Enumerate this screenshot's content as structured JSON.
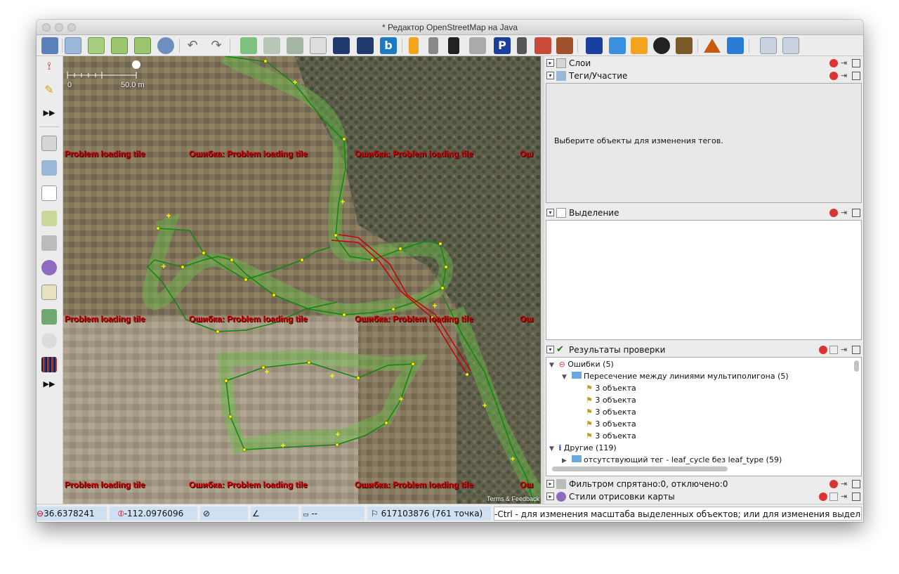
{
  "window": {
    "title": "* Редактор OpenStreetMap на Java"
  },
  "map": {
    "scale_zero": "0",
    "scale_label": "50.0 m",
    "tile_error": "Problem loading tile",
    "tile_error_ru": "Ошибка: Problem loading tile",
    "tile_error_cut": "Ош",
    "attribution": "Terms & Feedback"
  },
  "panels": {
    "layers": {
      "title": "Слои"
    },
    "tags": {
      "title": "Теги/Участие",
      "empty": "Выберите объекты для изменения тегов."
    },
    "selection": {
      "title": "Выделение"
    },
    "validation": {
      "title": "Результаты проверки",
      "errors": "Ошибки (5)",
      "group": "Пересечение между линиями мультиполигона (5)",
      "items": [
        "3 объекта",
        "3 объекта",
        "3 объекта",
        "3 объекта",
        "3 объекта"
      ],
      "others": "Другие (119)",
      "others_first": "отсутствующий тег - leaf_cycle без leaf_type (59)"
    },
    "filter": {
      "title": "Фильтром спрятано:0, отключено:0"
    },
    "styles": {
      "title": "Стили отрисовки карты"
    }
  },
  "status": {
    "lat": "36.6378241",
    "lon": "-112.0976096",
    "heading": "",
    "angle": "",
    "distance": "--",
    "way": "617103876 (761 точка)",
    "hint": "-Ctrl - для изменения масштаба выделенных объектов; или для изменения выделения"
  },
  "colors": {
    "accent": "#cfe0f2",
    "way": "#0a8a0a",
    "error": "#cc0000",
    "node": "#ffff00"
  }
}
